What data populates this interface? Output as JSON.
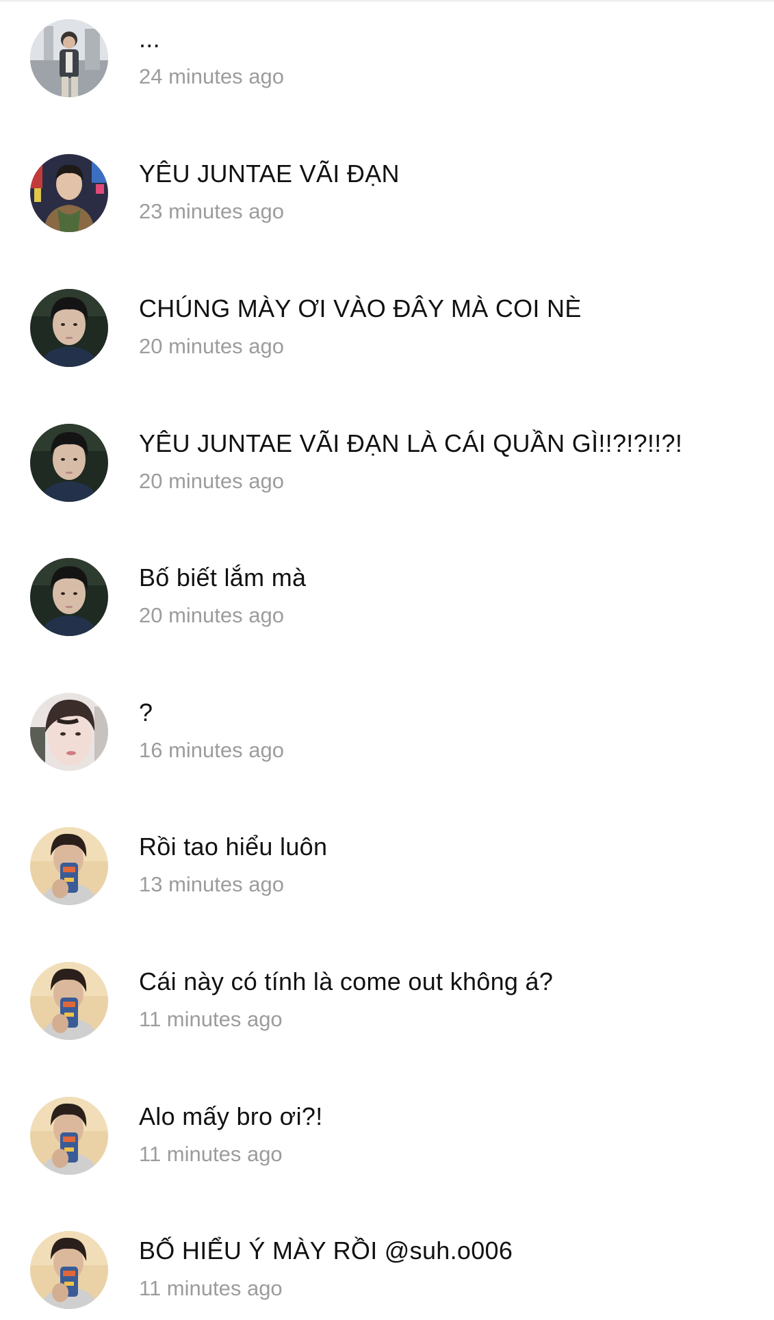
{
  "comments": [
    {
      "avatar": "avatar-photo-a",
      "text": "...",
      "time": "24 minutes ago"
    },
    {
      "avatar": "avatar-photo-b",
      "text": "YÊU JUNTAE VÃI ĐẠN",
      "time": "23 minutes ago"
    },
    {
      "avatar": "avatar-photo-c",
      "text": "CHÚNG MÀY ƠI VÀO ĐÂY MÀ COI NÈ",
      "time": "20 minutes ago"
    },
    {
      "avatar": "avatar-photo-c",
      "text": "YÊU JUNTAE VÃI ĐẠN LÀ CÁI QUẦN GÌ!!?!?!!?!",
      "time": "20 minutes ago"
    },
    {
      "avatar": "avatar-photo-c",
      "text": "Bố biết lắm mà",
      "time": "20 minutes ago"
    },
    {
      "avatar": "avatar-photo-d",
      "text": "?",
      "time": "16 minutes ago"
    },
    {
      "avatar": "avatar-photo-e",
      "text": "Rồi tao hiểu  luôn",
      "time": "13 minutes ago"
    },
    {
      "avatar": "avatar-photo-e",
      "text": "Cái này có tính là come out không á?",
      "time": "11 minutes ago"
    },
    {
      "avatar": "avatar-photo-e",
      "text": "Alo mấy bro ơi?!",
      "time": "11 minutes ago"
    },
    {
      "avatar": "avatar-photo-e",
      "text": "BỐ HIỂU Ý MÀY RỒI @suh.o006",
      "time": "11 minutes ago"
    }
  ]
}
